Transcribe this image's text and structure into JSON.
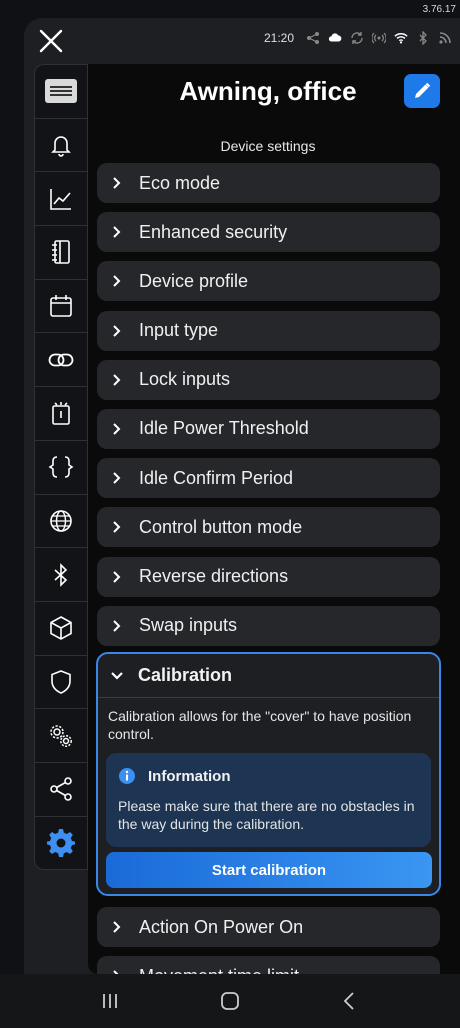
{
  "app_version": "3.76.17",
  "status_bar": {
    "time": "21:20"
  },
  "header": {
    "title": "Awning, office",
    "subtitle": "Device settings"
  },
  "sidebar": {
    "items": [
      {
        "icon": "device-logo-icon"
      },
      {
        "icon": "bell-icon"
      },
      {
        "icon": "chart-icon"
      },
      {
        "icon": "notebook-icon"
      },
      {
        "icon": "calendar-icon"
      },
      {
        "icon": "link-icon"
      },
      {
        "icon": "timer-icon"
      },
      {
        "icon": "braces-icon"
      },
      {
        "icon": "globe-icon"
      },
      {
        "icon": "bluetooth-icon"
      },
      {
        "icon": "cube-icon"
      },
      {
        "icon": "shield-icon"
      },
      {
        "icon": "gears-icon"
      },
      {
        "icon": "share-icon"
      },
      {
        "icon": "settings-gear-icon",
        "active": true
      }
    ]
  },
  "settings": [
    "Eco mode",
    "Enhanced security",
    "Device profile",
    "Input type",
    "Lock inputs",
    "Idle Power Threshold",
    "Idle Confirm Period",
    "Control button mode",
    "Reverse directions",
    "Swap inputs"
  ],
  "calibration": {
    "title": "Calibration",
    "description": "Calibration allows for the \"cover\" to have position control.",
    "info_title": "Information",
    "info_text": "Please make sure that there are no obstacles in the way during the calibration.",
    "button": "Start calibration"
  },
  "after_settings": [
    "Action On Power On",
    "Movement time limit"
  ],
  "colors": {
    "accent": "#1e7ae8",
    "active_icon": "#3d8ff0",
    "info_bg": "#1d3553"
  }
}
